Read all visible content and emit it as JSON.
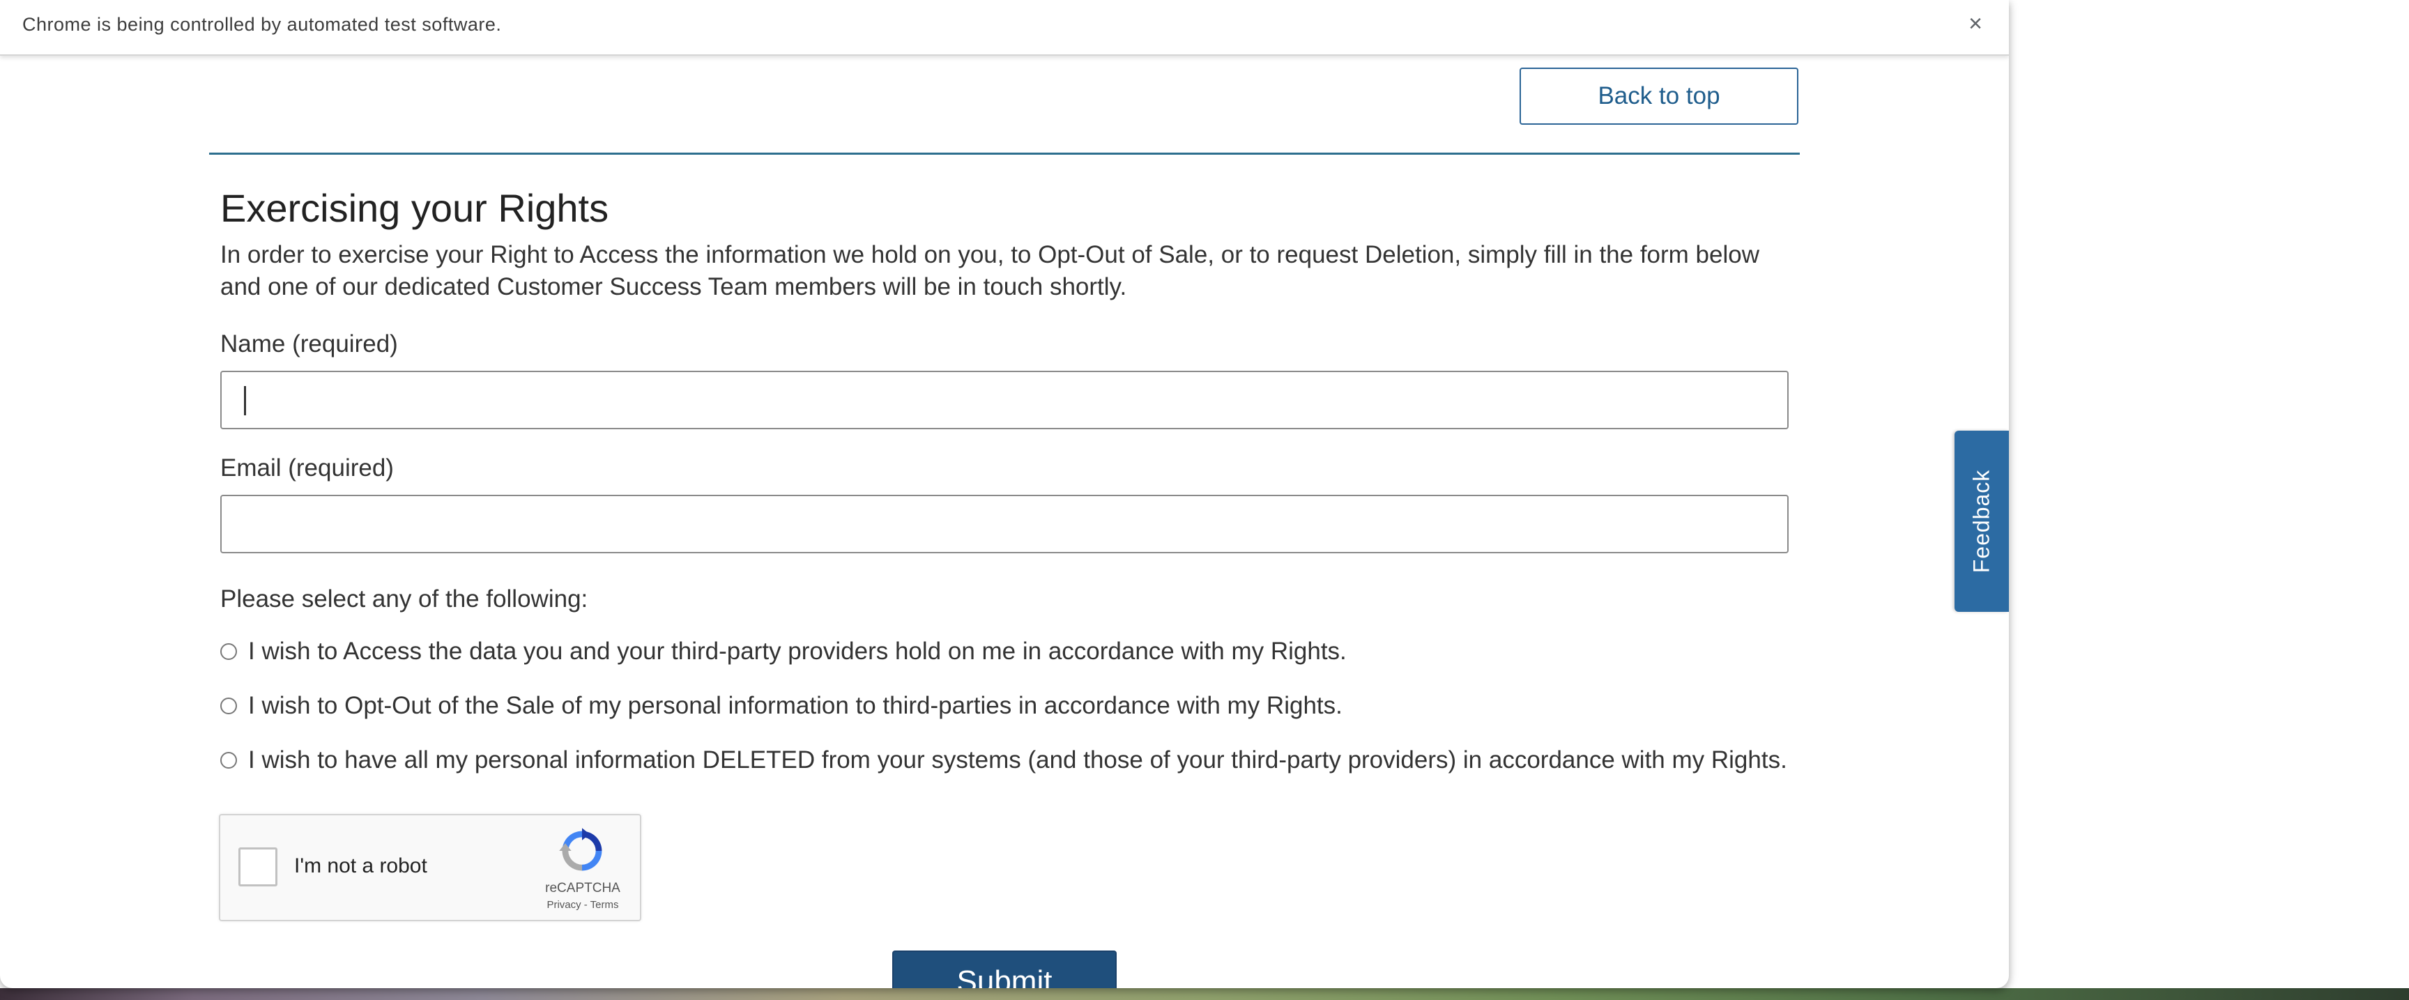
{
  "browser": {
    "infobar_text": "Chrome is being controlled by automated test software.",
    "close_glyph": "×"
  },
  "page": {
    "back_to_top": "Back to top",
    "section_title": "Exercising your Rights",
    "intro": "In order to exercise your Right to Access the information we hold on you, to Opt-Out of Sale, or to request Deletion, simply fill in the form below and one of our dedicated Customer Success Team members will be in touch shortly.",
    "form": {
      "name_label": "Name (required)",
      "name_value": "",
      "email_label": "Email (required)",
      "email_value": "",
      "select_prompt": "Please select any of the following:",
      "options": [
        {
          "label": "I wish to Access the data you and your third-party providers hold on me in accordance with my Rights.",
          "selected": false
        },
        {
          "label": "I wish to Opt-Out of the Sale of my personal information to third-parties in accordance with my Rights.",
          "selected": false
        },
        {
          "label": "I wish to have all my personal information DELETED from your systems (and those of your third-party providers) in accordance with my Rights.",
          "selected": false
        }
      ],
      "submit_label": "Submit"
    },
    "recaptcha": {
      "label": "I'm not a robot",
      "brand": "reCAPTCHA",
      "terms": "Privacy - Terms"
    },
    "feedback_tab": "Feedback"
  },
  "colors": {
    "accent_blue": "#2c6ba3",
    "submit_blue": "#1f4f7c",
    "divider_teal": "#2d6f8e"
  }
}
